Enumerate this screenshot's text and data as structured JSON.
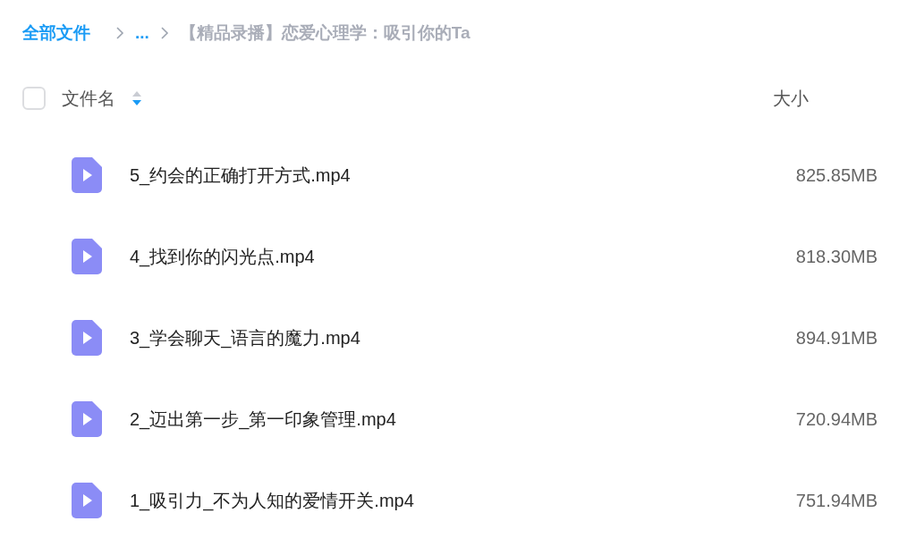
{
  "breadcrumb": [
    {
      "label": "全部文件",
      "kind": "link"
    },
    {
      "label": "...",
      "kind": "link"
    },
    {
      "label": "【精品录播】恋爱心理学：吸引你的Ta",
      "kind": "current"
    }
  ],
  "header": {
    "checked": false,
    "name_column": "文件名",
    "sort_descending": true,
    "size_column": "大小"
  },
  "files": [
    {
      "name": "5_约会的正确打开方式.mp4",
      "size": "825.85MB"
    },
    {
      "name": "4_找到你的闪光点.mp4",
      "size": "818.30MB"
    },
    {
      "name": "3_学会聊天_语言的魔力.mp4",
      "size": "894.91MB"
    },
    {
      "name": "2_迈出第一步_第一印象管理.mp4",
      "size": "720.94MB"
    },
    {
      "name": "1_吸引力_不为人知的爱情开关.mp4",
      "size": "751.94MB"
    }
  ]
}
